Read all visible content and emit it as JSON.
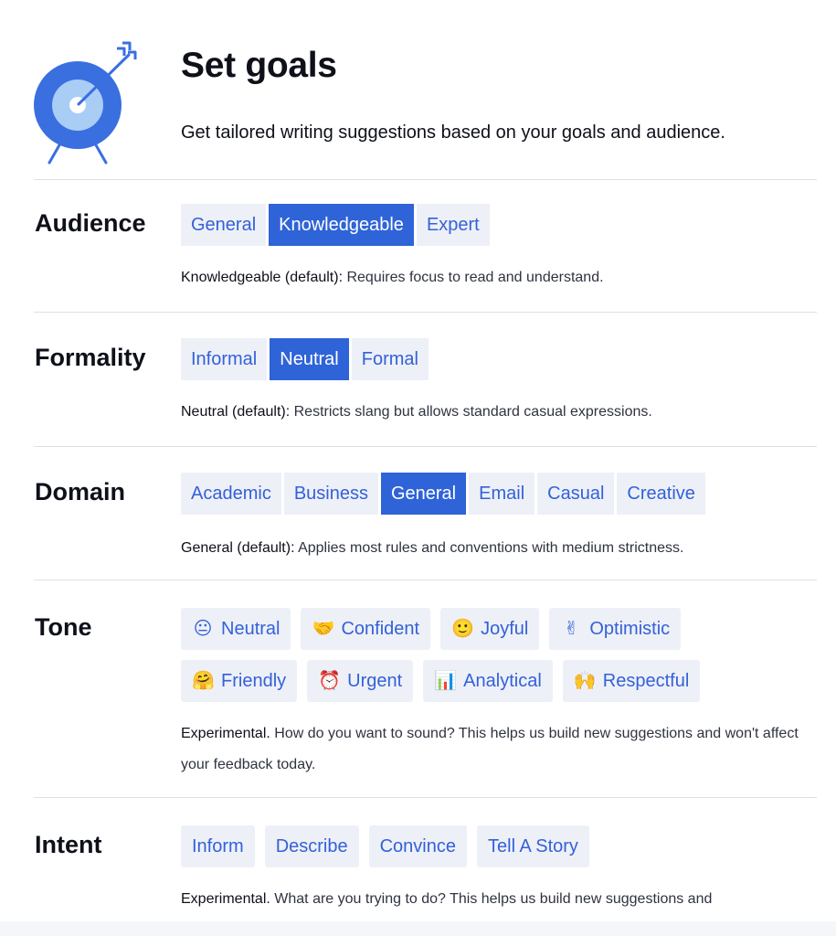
{
  "header": {
    "title": "Set goals",
    "subtitle": "Get tailored writing suggestions based on your goals and audience."
  },
  "audience": {
    "label": "Audience",
    "options": [
      "General",
      "Knowledgeable",
      "Expert"
    ],
    "selected": "Knowledgeable",
    "desc_bold": "Knowledgeable (default):",
    "desc_text": " Requires focus to read and understand."
  },
  "formality": {
    "label": "Formality",
    "options": [
      "Informal",
      "Neutral",
      "Formal"
    ],
    "selected": "Neutral",
    "desc_bold": "Neutral (default):",
    "desc_text": " Restricts slang but allows standard casual expressions."
  },
  "domain": {
    "label": "Domain",
    "options": [
      "Academic",
      "Business",
      "General",
      "Email",
      "Casual",
      "Creative"
    ],
    "selected": "General",
    "desc_bold": "General (default):",
    "desc_text": " Applies most rules and conventions with medium strictness."
  },
  "tone": {
    "label": "Tone",
    "row1": [
      {
        "emoji": "😐",
        "label": "Neutral"
      },
      {
        "emoji": "🤝",
        "label": "Confident"
      },
      {
        "emoji": "🙂",
        "label": "Joyful"
      },
      {
        "emoji": "✌",
        "label": "Optimistic"
      }
    ],
    "row2": [
      {
        "emoji": "🤗",
        "label": "Friendly"
      },
      {
        "emoji": "⏰",
        "label": "Urgent"
      },
      {
        "emoji": "📊",
        "label": "Analytical"
      },
      {
        "emoji": "🙌",
        "label": "Respectful"
      }
    ],
    "desc_bold": "Experimental.",
    "desc_text": " How do you want to sound? This helps us build new suggestions and won't affect your feedback today."
  },
  "intent": {
    "label": "Intent",
    "options": [
      "Inform",
      "Describe",
      "Convince",
      "Tell A Story"
    ],
    "desc_bold": "Experimental.",
    "desc_text": " What are you trying to do? This helps us build new suggestions and"
  },
  "colors": {
    "accent": "#2f63d8",
    "chip_bg": "#eef0f8",
    "chip_text": "#3361d8",
    "icon_outer": "#3a6fe0",
    "icon_inner": "#aacdf5"
  }
}
